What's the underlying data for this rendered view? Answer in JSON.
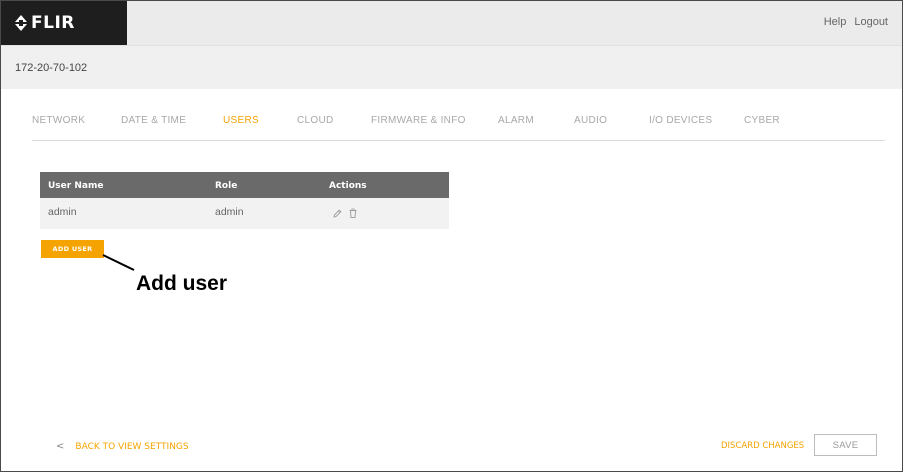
{
  "app": {
    "logo_text": "FLIR",
    "top_links": [
      "Help",
      "Logout"
    ]
  },
  "device": {
    "name": "172-20-70-102"
  },
  "tabs": [
    {
      "label": "NETWORK",
      "active": false
    },
    {
      "label": "DATE & TIME",
      "active": false
    },
    {
      "label": "USERS",
      "active": true
    },
    {
      "label": "CLOUD",
      "active": false
    },
    {
      "label": "FIRMWARE & INFO",
      "active": false
    },
    {
      "label": "ALARM",
      "active": false
    },
    {
      "label": "AUDIO",
      "active": false
    },
    {
      "label": "I/O DEVICES",
      "active": false
    },
    {
      "label": "CYBER",
      "active": false
    }
  ],
  "users_table": {
    "columns": [
      "User Name",
      "Role",
      "Actions"
    ],
    "rows": [
      {
        "user_name": "admin",
        "role": "admin",
        "actions": [
          "edit-icon",
          "delete-icon"
        ]
      }
    ]
  },
  "add_user_button": "ADD USER",
  "callout": {
    "text": "Add user"
  },
  "footer": {
    "back_chevron": "<",
    "back_label": "BACK TO VIEW SETTINGS",
    "discard_label": "DISCARD CHANGES",
    "save_label": "SAVE"
  },
  "colors": {
    "accent": "#f5a300",
    "header_dark": "#1e1e1e",
    "table_header": "#6a6a6a"
  }
}
